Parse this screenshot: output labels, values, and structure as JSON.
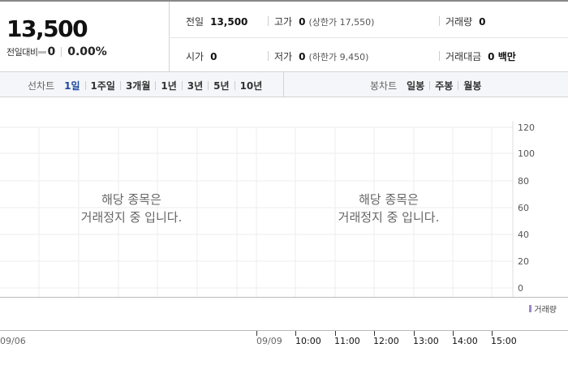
{
  "summary": {
    "price": "13,500",
    "change_label": "전일대비",
    "change_value": "0",
    "change_rate": "0.00%",
    "prev_close": {
      "label": "전일",
      "value": "13,500"
    },
    "high": {
      "label": "고가",
      "value": "0",
      "sub": "(상한가 17,550)"
    },
    "volume": {
      "label": "거래량",
      "value": "0"
    },
    "open": {
      "label": "시가",
      "value": "0"
    },
    "low": {
      "label": "저가",
      "value": "0",
      "sub": "(하한가 9,450)"
    },
    "trade_amount": {
      "label": "거래대금",
      "value": "0 백만"
    }
  },
  "line_chart_tabs": {
    "label": "선차트",
    "items": [
      "1일",
      "1주일",
      "3개월",
      "1년",
      "3년",
      "5년",
      "10년"
    ],
    "active": "1일"
  },
  "candle_chart_tabs": {
    "label": "봉차트",
    "items": [
      "일봉",
      "주봉",
      "월봉"
    ]
  },
  "chart": {
    "notice_line1": "해당 종목은",
    "notice_line2": "거래정지 중 입니다.",
    "y_ticks": [
      "120",
      "100",
      "80",
      "60",
      "40",
      "20",
      "0"
    ],
    "volume_legend": "거래량",
    "x_ticks": [
      "09/06",
      "09/09",
      "10:00",
      "11:00",
      "12:00",
      "13:00",
      "14:00",
      "15:00"
    ],
    "colors": {
      "active_tab": "#1c4ba0",
      "volume": "#9b8bc4",
      "grid": "#eeeeee"
    }
  }
}
